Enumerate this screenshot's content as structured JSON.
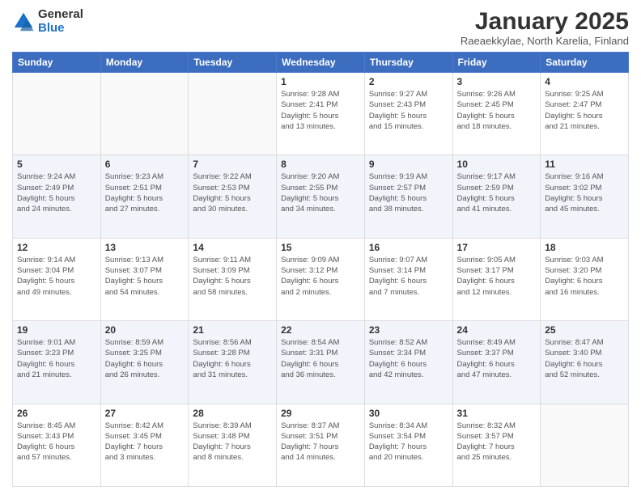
{
  "logo": {
    "general": "General",
    "blue": "Blue"
  },
  "header": {
    "title": "January 2025",
    "subtitle": "Raeaekkylae, North Karelia, Finland"
  },
  "weekdays": [
    "Sunday",
    "Monday",
    "Tuesday",
    "Wednesday",
    "Thursday",
    "Friday",
    "Saturday"
  ],
  "weeks": [
    [
      {
        "day": "",
        "info": ""
      },
      {
        "day": "",
        "info": ""
      },
      {
        "day": "",
        "info": ""
      },
      {
        "day": "1",
        "info": "Sunrise: 9:28 AM\nSunset: 2:41 PM\nDaylight: 5 hours\nand 13 minutes."
      },
      {
        "day": "2",
        "info": "Sunrise: 9:27 AM\nSunset: 2:43 PM\nDaylight: 5 hours\nand 15 minutes."
      },
      {
        "day": "3",
        "info": "Sunrise: 9:26 AM\nSunset: 2:45 PM\nDaylight: 5 hours\nand 18 minutes."
      },
      {
        "day": "4",
        "info": "Sunrise: 9:25 AM\nSunset: 2:47 PM\nDaylight: 5 hours\nand 21 minutes."
      }
    ],
    [
      {
        "day": "5",
        "info": "Sunrise: 9:24 AM\nSunset: 2:49 PM\nDaylight: 5 hours\nand 24 minutes."
      },
      {
        "day": "6",
        "info": "Sunrise: 9:23 AM\nSunset: 2:51 PM\nDaylight: 5 hours\nand 27 minutes."
      },
      {
        "day": "7",
        "info": "Sunrise: 9:22 AM\nSunset: 2:53 PM\nDaylight: 5 hours\nand 30 minutes."
      },
      {
        "day": "8",
        "info": "Sunrise: 9:20 AM\nSunset: 2:55 PM\nDaylight: 5 hours\nand 34 minutes."
      },
      {
        "day": "9",
        "info": "Sunrise: 9:19 AM\nSunset: 2:57 PM\nDaylight: 5 hours\nand 38 minutes."
      },
      {
        "day": "10",
        "info": "Sunrise: 9:17 AM\nSunset: 2:59 PM\nDaylight: 5 hours\nand 41 minutes."
      },
      {
        "day": "11",
        "info": "Sunrise: 9:16 AM\nSunset: 3:02 PM\nDaylight: 5 hours\nand 45 minutes."
      }
    ],
    [
      {
        "day": "12",
        "info": "Sunrise: 9:14 AM\nSunset: 3:04 PM\nDaylight: 5 hours\nand 49 minutes."
      },
      {
        "day": "13",
        "info": "Sunrise: 9:13 AM\nSunset: 3:07 PM\nDaylight: 5 hours\nand 54 minutes."
      },
      {
        "day": "14",
        "info": "Sunrise: 9:11 AM\nSunset: 3:09 PM\nDaylight: 5 hours\nand 58 minutes."
      },
      {
        "day": "15",
        "info": "Sunrise: 9:09 AM\nSunset: 3:12 PM\nDaylight: 6 hours\nand 2 minutes."
      },
      {
        "day": "16",
        "info": "Sunrise: 9:07 AM\nSunset: 3:14 PM\nDaylight: 6 hours\nand 7 minutes."
      },
      {
        "day": "17",
        "info": "Sunrise: 9:05 AM\nSunset: 3:17 PM\nDaylight: 6 hours\nand 12 minutes."
      },
      {
        "day": "18",
        "info": "Sunrise: 9:03 AM\nSunset: 3:20 PM\nDaylight: 6 hours\nand 16 minutes."
      }
    ],
    [
      {
        "day": "19",
        "info": "Sunrise: 9:01 AM\nSunset: 3:23 PM\nDaylight: 6 hours\nand 21 minutes."
      },
      {
        "day": "20",
        "info": "Sunrise: 8:59 AM\nSunset: 3:25 PM\nDaylight: 6 hours\nand 26 minutes."
      },
      {
        "day": "21",
        "info": "Sunrise: 8:56 AM\nSunset: 3:28 PM\nDaylight: 6 hours\nand 31 minutes."
      },
      {
        "day": "22",
        "info": "Sunrise: 8:54 AM\nSunset: 3:31 PM\nDaylight: 6 hours\nand 36 minutes."
      },
      {
        "day": "23",
        "info": "Sunrise: 8:52 AM\nSunset: 3:34 PM\nDaylight: 6 hours\nand 42 minutes."
      },
      {
        "day": "24",
        "info": "Sunrise: 8:49 AM\nSunset: 3:37 PM\nDaylight: 6 hours\nand 47 minutes."
      },
      {
        "day": "25",
        "info": "Sunrise: 8:47 AM\nSunset: 3:40 PM\nDaylight: 6 hours\nand 52 minutes."
      }
    ],
    [
      {
        "day": "26",
        "info": "Sunrise: 8:45 AM\nSunset: 3:43 PM\nDaylight: 6 hours\nand 57 minutes."
      },
      {
        "day": "27",
        "info": "Sunrise: 8:42 AM\nSunset: 3:45 PM\nDaylight: 7 hours\nand 3 minutes."
      },
      {
        "day": "28",
        "info": "Sunrise: 8:39 AM\nSunset: 3:48 PM\nDaylight: 7 hours\nand 8 minutes."
      },
      {
        "day": "29",
        "info": "Sunrise: 8:37 AM\nSunset: 3:51 PM\nDaylight: 7 hours\nand 14 minutes."
      },
      {
        "day": "30",
        "info": "Sunrise: 8:34 AM\nSunset: 3:54 PM\nDaylight: 7 hours\nand 20 minutes."
      },
      {
        "day": "31",
        "info": "Sunrise: 8:32 AM\nSunset: 3:57 PM\nDaylight: 7 hours\nand 25 minutes."
      },
      {
        "day": "",
        "info": ""
      }
    ]
  ]
}
